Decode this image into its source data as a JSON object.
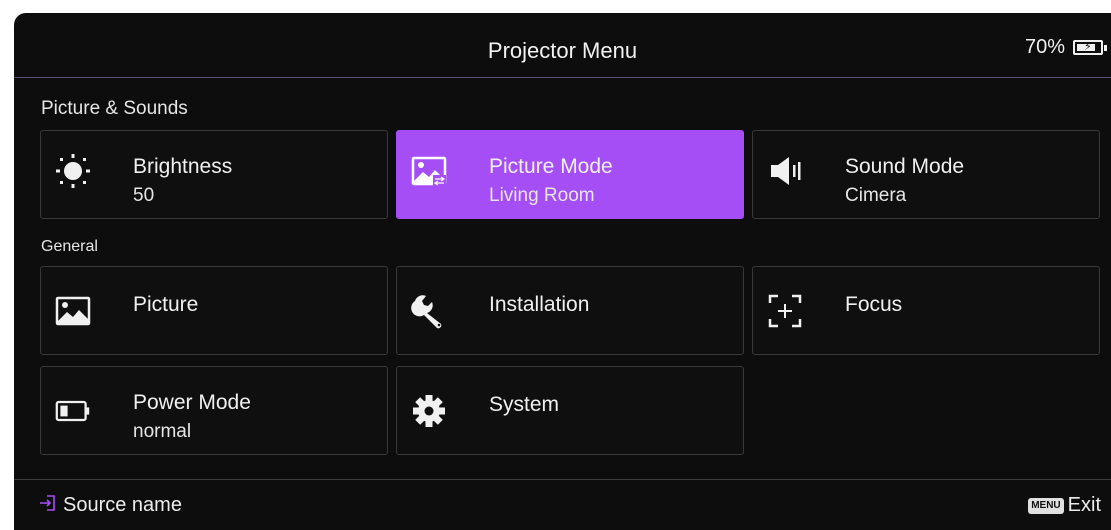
{
  "header": {
    "title": "Projector Menu",
    "battery_percent": "70%",
    "battery_level": 0.7
  },
  "sections": {
    "picture_sounds": "Picture & Sounds",
    "general": "General"
  },
  "tiles": {
    "brightness": {
      "label": "Brightness",
      "value": "50",
      "icon": "sun-icon"
    },
    "picture_mode": {
      "label": "Picture Mode",
      "value": "Living Room",
      "icon": "picture-mode-icon",
      "selected": true
    },
    "sound_mode": {
      "label": "Sound Mode",
      "value": "Cimera",
      "icon": "speaker-icon"
    },
    "picture": {
      "label": "Picture",
      "icon": "image-icon"
    },
    "installation": {
      "label": "Installation",
      "icon": "wrench-icon"
    },
    "focus": {
      "label": "Focus",
      "icon": "focus-icon"
    },
    "power_mode": {
      "label": "Power Mode",
      "value": "normal",
      "icon": "battery-icon"
    },
    "system": {
      "label": "System",
      "icon": "gear-icon"
    }
  },
  "footer": {
    "source_label": "Source name",
    "menu_key": "MENU",
    "exit_label": "Exit"
  },
  "colors": {
    "accent": "#a64ef5",
    "background": "#0d0d0d",
    "tile_border": "#3a3a3a"
  }
}
